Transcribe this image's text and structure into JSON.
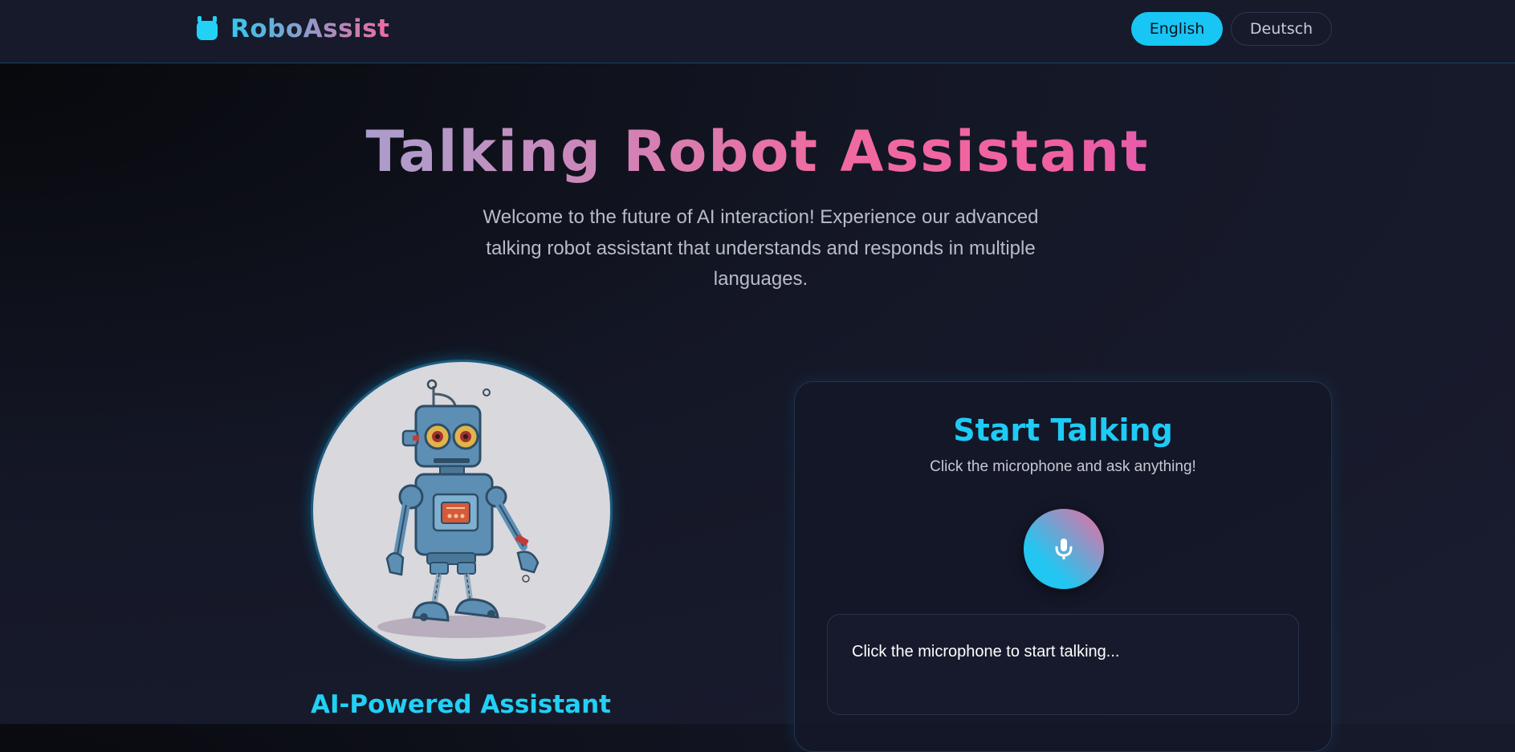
{
  "brand": {
    "name": "RoboAssist",
    "icon": "robot-icon",
    "accent": "#22d2f5"
  },
  "language": {
    "english_label": "English",
    "german_label": "Deutsch",
    "active": "English"
  },
  "hero": {
    "title": "Talking Robot Assistant",
    "subtitle": "Welcome to the future of AI interaction! Experience our advanced talking robot assistant that understands and responds in multiple languages."
  },
  "showcase": {
    "title": "AI-Powered Assistant",
    "image": "robot-illustration"
  },
  "talk_panel": {
    "title": "Start Talking",
    "subtitle": "Click the microphone and ask anything!",
    "mic_icon": "microphone-icon",
    "transcript": "Click the microphone to start talking..."
  },
  "colors": {
    "primary": "#17c6f4",
    "pink": "#f06aa0",
    "purple": "#b84bd8",
    "background": "#141726"
  }
}
